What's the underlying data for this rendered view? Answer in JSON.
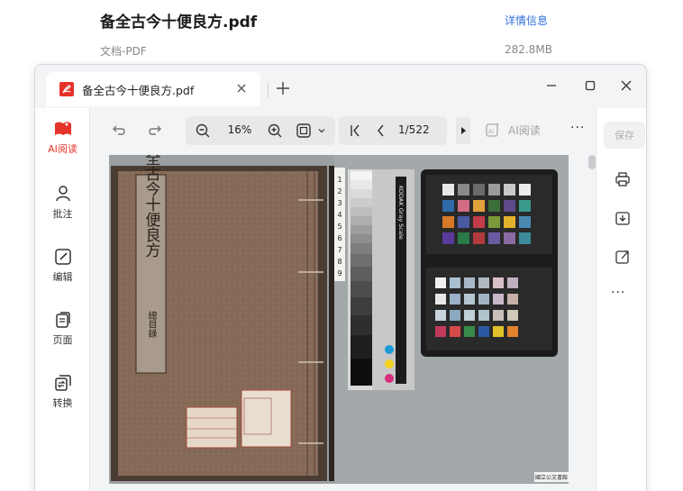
{
  "file": {
    "title": "备全古今十便良方.pdf",
    "detail_link": "详情信息",
    "type": "文档-PDF",
    "size": "282.8MB"
  },
  "viewer": {
    "tab_label": "备全古今十便良方.pdf",
    "left_nav": [
      {
        "label": "AI阅读",
        "icon": "ai-read-icon"
      },
      {
        "label": "批注",
        "icon": "annotate-icon"
      },
      {
        "label": "编辑",
        "icon": "edit-icon"
      },
      {
        "label": "页面",
        "icon": "pages-icon"
      },
      {
        "label": "转换",
        "icon": "convert-icon"
      }
    ],
    "toolbar": {
      "zoom": "16%",
      "page": "1/522",
      "ai_read": "AI阅读"
    },
    "right": {
      "save": "保存"
    }
  },
  "document": {
    "book_title": "備全古今十便良方",
    "book_subtitle": "總目錄",
    "kodak_label": "KODAK Gray Scale",
    "library_stamp": "國立公文書館",
    "ruler_numbers": [
      "1",
      "2",
      "3",
      "4",
      "5",
      "6",
      "7",
      "8",
      "9"
    ]
  },
  "colors": {
    "accent_red": "#e6332a",
    "link_blue": "#2f6fdc"
  }
}
